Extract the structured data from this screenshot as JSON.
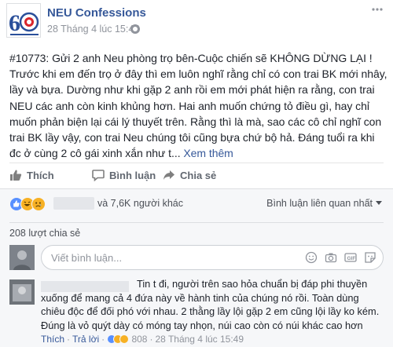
{
  "post": {
    "page_name": "NEU Confessions",
    "timestamp": "28 Tháng 4 lúc 15:45",
    "text": "#10773: Gửi 2 anh Neu phòng trọ bên-Cuộc chiến sẽ KHÔNG DỪNG LẠI ! Trước khi em đến trọ ở đây thì em luôn nghĩ rằng chỉ có con trai BK mới nhây, lầy và bựa. Dường như khi gặp 2 anh rồi em mới phát hiện ra rằng, con trai NEU các anh còn kinh khủng hơn. Hai anh muốn chứng tỏ điều gì, hay chỉ muốn phản biện lại cái lý thuyết trên. Rằng thì là mà, sao các cô chỉ nghĩ con trai BK lầy vậy, con trai Neu chúng tôi cũng bựa chứ bộ hả. Đáng tuổi ra khi đc ở cùng 2 cô gái xinh xắn như t...",
    "see_more": "Xem thêm"
  },
  "actions": {
    "like": "Thích",
    "comment": "Bình luận",
    "share": "Chia sẻ"
  },
  "reactions": {
    "count_text": "và 7,6K người khác",
    "filter_label": "Bình luận liên quan nhất",
    "colors": {
      "like": "#5890ff",
      "haha": "#f7b125"
    }
  },
  "shares": {
    "text": "208 lượt chia sẻ"
  },
  "composer": {
    "placeholder": "Viết bình luận..."
  },
  "comment": {
    "text": "Tin t đi, người trên sao hỏa chuẩn bị đáp phi thuyền xuống để mang cả 4 đứa này về hành tinh của chúng nó rồi. Toàn dùng chiêu độc để đối phó với nhau. 2 thằng lầy lội gặp 2 em cũng lội lầy ko kém. Đúng là vỏ quýt dày có móng tay nhọn, núi cao còn có núi khác cao hơn",
    "like_label": "Thích",
    "reply_label": "Trả lời",
    "reaction_count": "808",
    "timestamp": "28 Tháng 4 lúc 15:49"
  },
  "colors": {
    "link": "#365899",
    "meta": "#90949c",
    "text": "#1d2129"
  }
}
